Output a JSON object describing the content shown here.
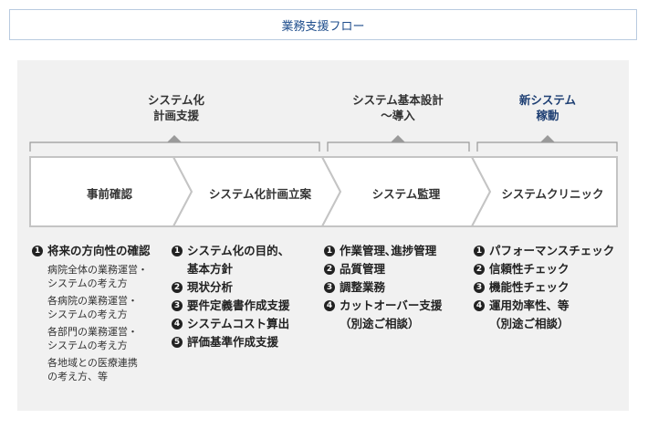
{
  "title": "業務支援フロー",
  "phases": [
    {
      "label": "システム化\n計画支援"
    },
    {
      "label": "システム基本設計\n〜導入"
    },
    {
      "label": "新システム\n稼動"
    }
  ],
  "steps": [
    {
      "label": "事前確認"
    },
    {
      "label": "システム化計画立案"
    },
    {
      "label": "システム監理"
    },
    {
      "label": "システムクリニック"
    }
  ],
  "lists": [
    {
      "items": [
        {
          "num": "1",
          "text": "将来の方向性の確認",
          "subs": [
            "病院全体の業務運営・\nシステムの考え方",
            "各病院の業務運営・\nシステムの考え方",
            "各部門の業務運営・\nシステムの考え方",
            "各地域との医療連携\nの考え方、等"
          ]
        }
      ]
    },
    {
      "items": [
        {
          "num": "1",
          "text": "システム化の目的、\n基本方針"
        },
        {
          "num": "2",
          "text": "現状分析"
        },
        {
          "num": "3",
          "text": "要件定義書作成支援"
        },
        {
          "num": "4",
          "text": "システムコスト算出"
        },
        {
          "num": "5",
          "text": "評価基準作成支援"
        }
      ]
    },
    {
      "items": [
        {
          "num": "1",
          "text": "作業管理､進捗管理"
        },
        {
          "num": "2",
          "text": "品質管理"
        },
        {
          "num": "3",
          "text": "調整業務"
        },
        {
          "num": "4",
          "text": "カットオーバー支援\n（別途ご相談）"
        }
      ]
    },
    {
      "items": [
        {
          "num": "1",
          "text": "パフォーマンスチェック"
        },
        {
          "num": "2",
          "text": "信頼性チェック"
        },
        {
          "num": "3",
          "text": "機能性チェック"
        },
        {
          "num": "4",
          "text": "運用効率性、等\n（別途ご相談）"
        }
      ]
    }
  ],
  "colors": {
    "accent": "#1e3f73",
    "arrow_fill": "#ffffff",
    "arrow_stroke": "#c4c4c4",
    "panel": "#f1f1f1"
  }
}
